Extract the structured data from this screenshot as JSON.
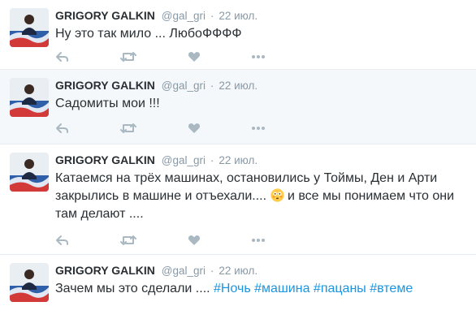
{
  "colors": {
    "hashtag": "#1b95e0",
    "meta": "#8899a6",
    "action_icon": "#aab8c2",
    "highlight_bg": "#f5f8fa",
    "divider": "#e6ecf0"
  },
  "tweets": [
    {
      "author_name": "GRIGORY GALKIN",
      "handle": "@gal_gri",
      "separator": "·",
      "time": "22 июл.",
      "text_parts": [
        {
          "text": "Ну это так мило ... ЛюбоФФФФ"
        }
      ],
      "highlight": false,
      "actions": [
        "reply-icon",
        "retweet-icon",
        "like-icon",
        "more-icon"
      ]
    },
    {
      "author_name": "GRIGORY GALKIN",
      "handle": "@gal_gri",
      "separator": "·",
      "time": "22 июл.",
      "text_parts": [
        {
          "text": "Садомиты мои !!!"
        }
      ],
      "highlight": true,
      "actions": [
        "reply-icon",
        "retweet-icon",
        "like-icon",
        "more-icon"
      ]
    },
    {
      "author_name": "GRIGORY GALKIN",
      "handle": "@gal_gri",
      "separator": "·",
      "time": "22 июл.",
      "text_parts": [
        {
          "text": "Катаемся на трёх машинах, остановились у Тоймы, Ден и Арти закрылись в машине и отъехали.... "
        },
        {
          "emoji": "flushed-face-emoji"
        },
        {
          "text": " и все мы понимаем что они там делают ...."
        }
      ],
      "highlight": false,
      "actions": [
        "reply-icon",
        "retweet-icon",
        "like-icon",
        "more-icon"
      ]
    },
    {
      "author_name": "GRIGORY GALKIN",
      "handle": "@gal_gri",
      "separator": "·",
      "time": "22 июл.",
      "text_parts": [
        {
          "text": "Зачем мы это сделали .... "
        },
        {
          "hashtag": "#Ночь"
        },
        {
          "text": " "
        },
        {
          "hashtag": "#машина"
        },
        {
          "text": " "
        },
        {
          "hashtag": "#пацаны"
        },
        {
          "text": " "
        },
        {
          "hashtag": "#втеме"
        }
      ],
      "highlight": false,
      "actions": []
    }
  ]
}
